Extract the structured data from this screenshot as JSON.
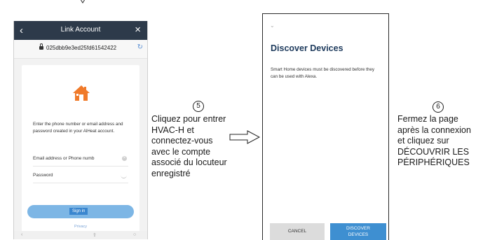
{
  "link_account_screen": {
    "title": "Link Account",
    "url": "025dbb9e3ed25fd61542422",
    "instructions": "Enter the phone number or email address and password created in your AlHeat account.",
    "email_placeholder": "Email address or Phone numb",
    "password_placeholder": "Password",
    "sign_in_label": "Sign in",
    "privacy_label": "Privacy",
    "accent_color": "#f07a2a"
  },
  "step5": {
    "number": "5",
    "text": "Cliquez pour entrer\nHVAC-H et\nconnectez-vous\navec le compte\nassocié du locuteur\nenregistré"
  },
  "discover_screen": {
    "title": "Discover Devices",
    "description": "Smart Home devices must be discovered before they can be used with Alexa.",
    "cancel_label": "CANCEL",
    "discover_label": "DISCOVER\nDEVICES",
    "title_color": "#1d3a5c",
    "button_color": "#3e8fd1"
  },
  "step6": {
    "number": "6",
    "text": "Fermez la page\naprès la connexion\net cliquez sur\nDÉCOUVRIR LES\nPÉRIPHÉRIQUES"
  }
}
